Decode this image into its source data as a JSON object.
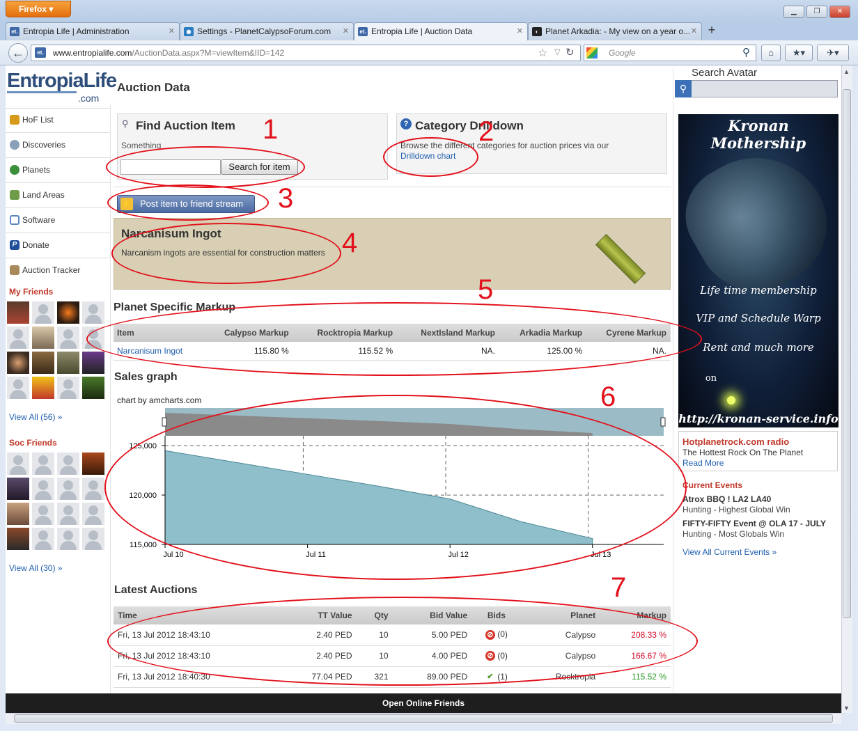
{
  "browser": {
    "menu_label": "Firefox",
    "window_buttons": [
      "minimize-icon",
      "restore-icon",
      "close-icon"
    ],
    "tabs": [
      {
        "label": "Entropia Life | Administration",
        "fav": "et."
      },
      {
        "label": "Settings - PlanetCalypsoForum.com",
        "fav": "◉"
      },
      {
        "label": "Entropia Life | Auction Data",
        "fav": "et."
      },
      {
        "label": "Planet Arkadia: - My view on a year o...",
        "fav": "◐"
      }
    ],
    "new_tab": "+",
    "url_domain": "www.entropialife.com",
    "url_path": "/AuctionData.aspx?M=viewItem&IID=142",
    "url_fav": "et.",
    "search_placeholder": "Google"
  },
  "site": {
    "logo_main": "EntropiaLife",
    "logo_suffix": ".com",
    "nav": [
      {
        "label": "HoF List",
        "icon": "trophy-icon",
        "color": "#d79a1a"
      },
      {
        "label": "Discoveries",
        "icon": "magnifier-icon",
        "color": "#8aa0b8"
      },
      {
        "label": "Planets",
        "icon": "globe-icon",
        "color": "#3a8f3a"
      },
      {
        "label": "Land Areas",
        "icon": "map-icon",
        "color": "#6f9c48"
      },
      {
        "label": "Software",
        "icon": "window-icon",
        "color": "#5b86c4"
      },
      {
        "label": "Donate",
        "icon": "paypal-icon",
        "color": "#1f4f9b"
      },
      {
        "label": "Auction Tracker",
        "icon": "hammer-icon",
        "color": "#a98a5a"
      }
    ],
    "my_friends_title": "My Friends",
    "my_friends_view_all": "View All (56) »",
    "soc_friends_title": "Soc Friends",
    "soc_friends_view_all": "View All (30) »"
  },
  "main": {
    "heading": "Auction Data",
    "find": {
      "title": "Find Auction Item",
      "subtitle": "Something",
      "input_value": "",
      "button": "Search for item"
    },
    "category": {
      "title": "Category Drilldown",
      "text": "Browse the different categories for auction prices via our",
      "link": "Drilldown chart"
    },
    "post_button": "Post item to friend stream",
    "item": {
      "name": "Narcanisum Ingot",
      "description": "Narcanism ingots are essential for construction matters"
    },
    "markup": {
      "title": "Planet Specific Markup",
      "headers": [
        "Item",
        "Calypso Markup",
        "Rocktropia Markup",
        "NextIsland Markup",
        "Arkadia Markup",
        "Cyrene Markup"
      ],
      "row": [
        "Narcanisum Ingot",
        "115.80 %",
        "115.52 %",
        "NA.",
        "125.00 %",
        "NA."
      ]
    },
    "sales": {
      "title": "Sales graph",
      "credit": "chart by amcharts.com"
    },
    "latest": {
      "title": "Latest Auctions",
      "headers": [
        "Time",
        "TT Value",
        "Qty",
        "Bid Value",
        "Bids",
        "Planet",
        "Markup"
      ],
      "rows": [
        [
          "Fri, 13 Jul 2012 18:43:10",
          "2.40 PED",
          "10",
          "5.00 PED",
          "(0)",
          "Calypso",
          "208.33 %"
        ],
        [
          "Fri, 13 Jul 2012 18:43:10",
          "2.40 PED",
          "10",
          "4.00 PED",
          "(0)",
          "Calypso",
          "166.67 %"
        ],
        [
          "Fri, 13 Jul 2012 18:40:30",
          "77.04 PED",
          "321",
          "89.00 PED",
          "(1)",
          "Rocktropia",
          "115.52 %"
        ]
      ],
      "bid_icons": [
        "no-bids-icon",
        "no-bids-icon",
        "checkmark-icon"
      ],
      "markup_colors": [
        "#d0112b",
        "#d0112b",
        "#2a9a2a"
      ]
    }
  },
  "right": {
    "search_title": "Search Avatar",
    "ad": {
      "title": "Kronan Mothership",
      "lines": [
        "Life time membership",
        "VIP and Schedule Warp",
        "Rent and much more",
        "on"
      ],
      "url": "http://kronan-service.info"
    },
    "radio": {
      "title": "Hotplanetrock.com radio",
      "text": "The Hottest Rock On The Planet",
      "link": "Read More"
    },
    "events_title": "Current Events",
    "events": [
      {
        "name": "Atrox BBQ ! LA2 LA40",
        "desc": "Hunting - Highest Global Win"
      },
      {
        "name": "FIFTY-FIFTY Event @ OLA 17 - JULY",
        "desc": "Hunting - Most Globals Win"
      }
    ],
    "events_link": "View All Current Events »"
  },
  "footer": {
    "online_friends": "Open Online Friends"
  },
  "annotations": [
    "1",
    "2",
    "3",
    "4",
    "5",
    "6",
    "7"
  ],
  "chart_data": {
    "type": "area",
    "title": "",
    "x_labels": [
      "Jul 10",
      "Jul 11",
      "Jul 12",
      "Jul 13"
    ],
    "y_ticks": [
      "125,000",
      "120,000",
      "115,000"
    ],
    "ylim": [
      115000,
      126000
    ],
    "grid": true,
    "series": [
      {
        "x": [
          0,
          0.5,
          1,
          1.5,
          2,
          2.5,
          3
        ],
        "values": [
          124500,
          123300,
          122100,
          120900,
          119600,
          117300,
          115600
        ]
      }
    ]
  }
}
